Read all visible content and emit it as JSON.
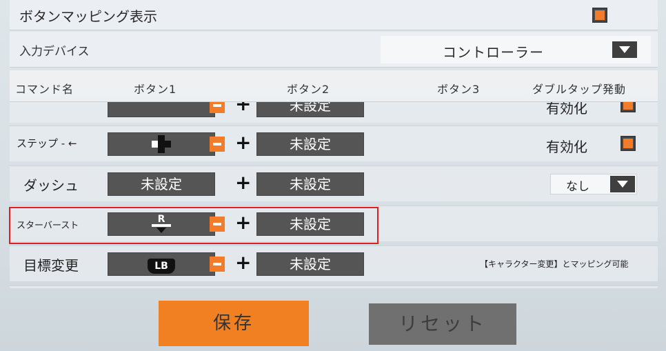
{
  "settings": {
    "button_mapping_label": "ボタンマッピング表示",
    "button_mapping_checked": true
  },
  "device": {
    "label": "入力デバイス",
    "value": "コントローラー"
  },
  "headers": {
    "command": "コマンド名",
    "button1": "ボタン1",
    "button2": "ボタン2",
    "button3": "ボタン3",
    "double_tap": "ダブルタップ発動"
  },
  "rows": [
    {
      "name": "",
      "button1": "",
      "button2": "未設定",
      "right": "有効化"
    },
    {
      "name": "ステップ - ←",
      "button1": "",
      "button2": "未設定",
      "right": "有効化"
    },
    {
      "name": "ダッシュ",
      "button1": "未設定",
      "button2": "未設定",
      "right": "なし"
    },
    {
      "name": "スターバースト",
      "button1_glyph": "R",
      "button2": "未設定"
    },
    {
      "name": "目標変更",
      "button1_glyph": "LB",
      "button2": "未設定",
      "note": "【キャラクター変更】とマッピング可能"
    }
  ],
  "actions": {
    "save": "保存",
    "reset": "リセット"
  },
  "colors": {
    "accent": "#f37c2b",
    "highlight": "#e02020"
  }
}
